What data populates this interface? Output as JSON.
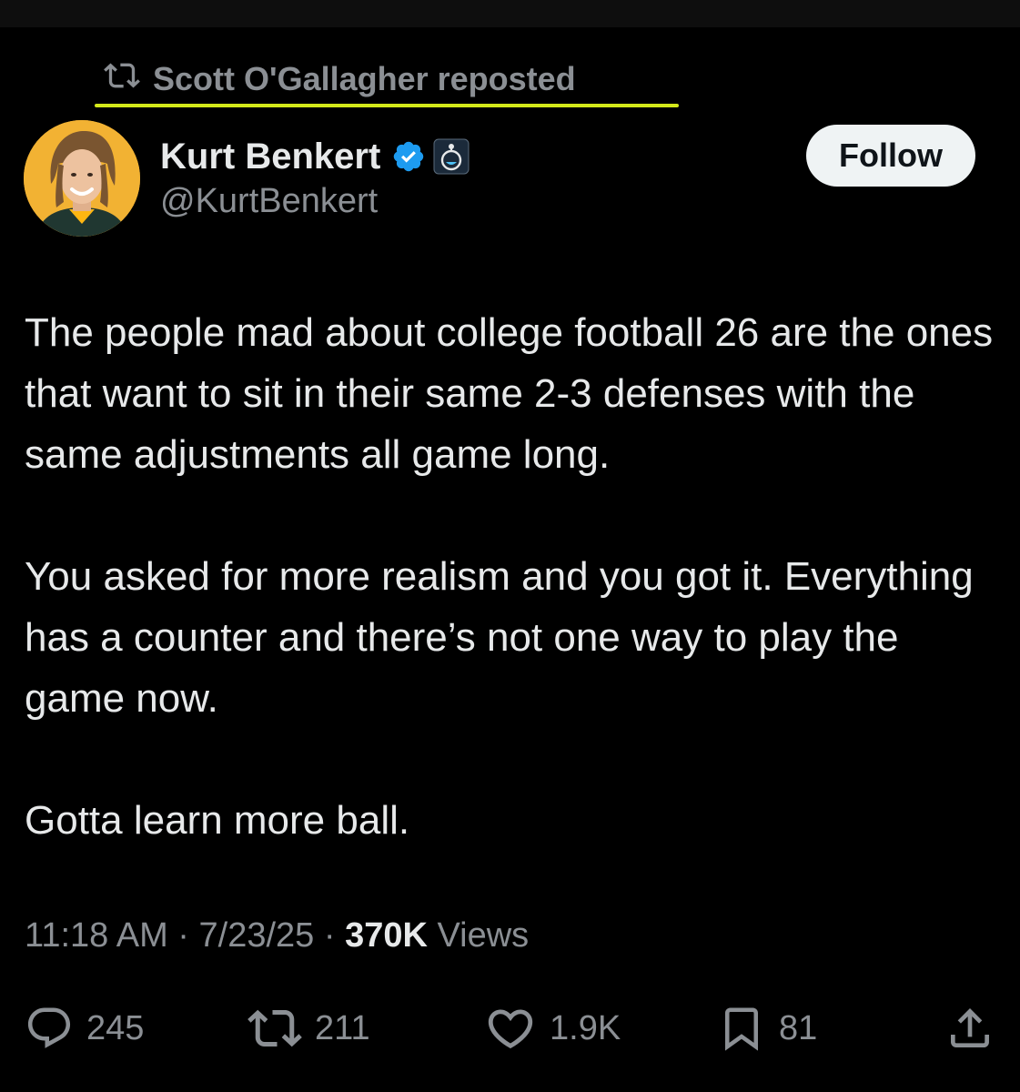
{
  "repost": {
    "icon": "repost-icon",
    "text": "Scott O'Gallagher reposted",
    "underline_color": "#d4e91a"
  },
  "author": {
    "display_name": "Kurt Benkert",
    "handle": "@KurtBenkert",
    "verified_icon": "verified-badge-icon",
    "affiliate_icon": "affiliate-badge-icon",
    "verified_color": "#1d9bf0"
  },
  "follow": {
    "label": "Follow"
  },
  "tweet": {
    "paragraphs": [
      "The people mad about college football 26 are the ones that want to sit in their same 2-3 defenses with the same adjustments all game long.",
      "You asked for more realism and you got it. Everything has a counter and there’s not one way to play the game now.",
      "Gotta learn more ball."
    ]
  },
  "meta": {
    "time": "11:18 AM",
    "separator": " · ",
    "date": "7/23/25",
    "views_count": "370K",
    "views_label": " Views"
  },
  "actions": {
    "replies": "245",
    "reposts": "211",
    "likes": "1.9K",
    "bookmarks": "81"
  },
  "colors": {
    "background": "#000000",
    "text": "#e7e9ea",
    "muted": "#8b8f94"
  }
}
